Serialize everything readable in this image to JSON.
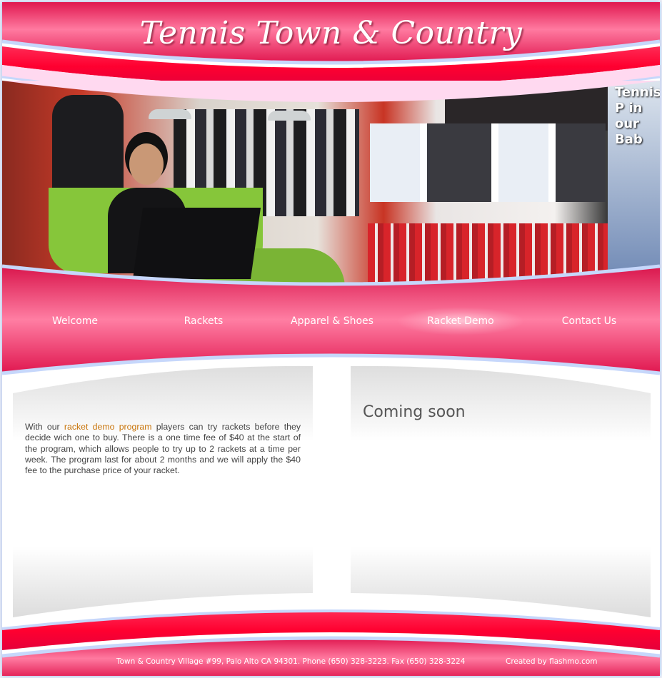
{
  "header": {
    "title": "Tennis Town & Country"
  },
  "photo": {
    "promo_text": "Tennis P in our Bab"
  },
  "nav": {
    "items": [
      {
        "label": "Welcome"
      },
      {
        "label": "Rackets"
      },
      {
        "label": "Apparel & Shoes"
      },
      {
        "label": "Racket Demo",
        "active": true
      },
      {
        "label": "Contact Us"
      }
    ]
  },
  "content": {
    "left": {
      "text_before": "With our ",
      "link_text": "racket demo program",
      "text_after": " players can try rackets before they decide wich one to buy. There is a one time fee of $40 at the start of the program, which allows people to try up to 2 rackets at a time per week. The program last for about 2 months and we will apply the $40 fee to the purchase price of your racket."
    },
    "right": {
      "heading": "Coming soon"
    }
  },
  "footer": {
    "address": "Town & Country Village #99, Palo Alto CA 94301. Phone (650) 328-3223. Fax (650) 328-3224",
    "credit": "Created by flashmo.com"
  },
  "colors": {
    "brand_pink": "#e0174f",
    "highlight_pink": "#ff6f94",
    "pale_pink": "#ffd9f0",
    "glow_blue": "#a9c2f2",
    "link": "#c8740a"
  }
}
